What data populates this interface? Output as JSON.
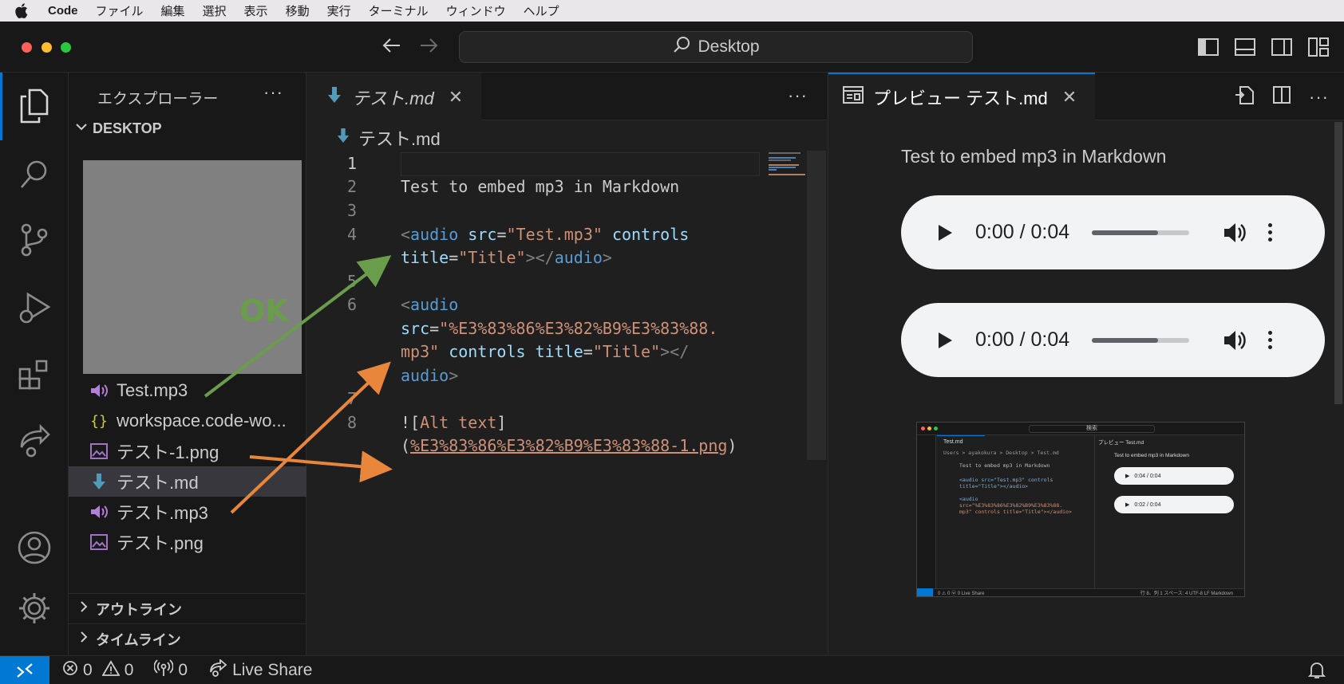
{
  "menubar": {
    "app_name": "Code",
    "items": [
      "ファイル",
      "編集",
      "選択",
      "表示",
      "移動",
      "実行",
      "ターミナル",
      "ウィンドウ",
      "ヘルプ"
    ]
  },
  "titlebar": {
    "search_text": "Desktop"
  },
  "sidebar": {
    "title": "エクスプローラー",
    "folder": "DESKTOP",
    "files": [
      {
        "name": "Test.mp3",
        "icon": "audio-file-icon"
      },
      {
        "name": "workspace.code-wo...",
        "icon": "json-file-icon"
      },
      {
        "name": "テスト-1.png",
        "icon": "image-file-icon"
      },
      {
        "name": "テスト.md",
        "icon": "markdown-file-icon",
        "selected": true
      },
      {
        "name": "テスト.mp3",
        "icon": "audio-file-icon"
      },
      {
        "name": "テスト.png",
        "icon": "image-file-icon"
      }
    ],
    "outline": "アウトライン",
    "timeline": "タイムライン"
  },
  "editor": {
    "tab_label": "テスト.md",
    "breadcrumb": "テスト.md",
    "line_numbers": [
      "1",
      "2",
      "3",
      "4",
      "5",
      "6",
      "7",
      "8"
    ],
    "lines": {
      "l2": "Test to embed mp3 in Markdown",
      "l4a_open": "<",
      "l4a_tag": "audio",
      "l4a_attr": " src",
      "l4a_eq": "=",
      "l4a_str": "\"Test.mp3\"",
      "l4a_attr2": " controls",
      "l4b_attr": "title",
      "l4b_eq": "=",
      "l4b_str": "\"Title\"",
      "l4b_close1": "></",
      "l4b_tag": "audio",
      "l4b_close2": ">",
      "l6a_open": "<",
      "l6a_tag": "audio",
      "l6b_attr": "src",
      "l6b_eq": "=",
      "l6b_str": "\"%E3%83%86%E3%82%B9%E3%83%88.",
      "l6c_str": "mp3\"",
      "l6c_attr": " controls title",
      "l6c_eq": "=",
      "l6c_str2": "\"Title\"",
      "l6c_close": "></",
      "l6d_tag": "audio",
      "l6d_close": ">",
      "l8a_bang": "![",
      "l8a_alt": "Alt text",
      "l8a_close": "]",
      "l8b_open": "(",
      "l8b_link": "%E3%83%86%E3%82%B9%E3%83%88-1.png",
      "l8b_close": ")"
    }
  },
  "preview": {
    "tab_label": "プレビュー テスト.md",
    "heading": "Test to embed mp3 in Markdown",
    "players": [
      {
        "time": "0:00 / 0:04",
        "progress": 0.68
      },
      {
        "time": "0:00 / 0:04",
        "progress": 0.68
      }
    ],
    "mini": {
      "search": "検索",
      "tab": "Test.md",
      "preview_tab": "プレビュー Test.md",
      "path": "Users > ayakokura > Desktop > Test.md",
      "heading": "Test to embed mp3 in Markdown",
      "code_l2": "Test to embed mp3 in Markdown",
      "code_l4": "<audio src=\"Test.mp3\" controls",
      "code_l4b": "title=\"Title\"></audio>",
      "code_l6": "<audio",
      "code_l6b": "src=\"%E3%83%86%E3%82%B9%E3%83%88.",
      "code_l6c": "mp3\" controls title=\"Title\"></audio>",
      "time1": "0:04 / 0:04",
      "time2": "0:02 / 0:04",
      "status_left": "0 ⚠ 0   ⓦ 0   Live Share",
      "status_right": "行 8、列 1   スペース: 4   UTF-8   LF   Markdown"
    }
  },
  "annotation": {
    "ok_label": "OK",
    "green": "#6a9d4b",
    "orange": "#e8863c"
  },
  "statusbar": {
    "errors": "0",
    "warnings": "0",
    "ports": "0",
    "live_share": "Live Share"
  },
  "colors": {
    "accent": "#0078d4",
    "bg": "#1f1f1f",
    "panel": "#181818"
  }
}
